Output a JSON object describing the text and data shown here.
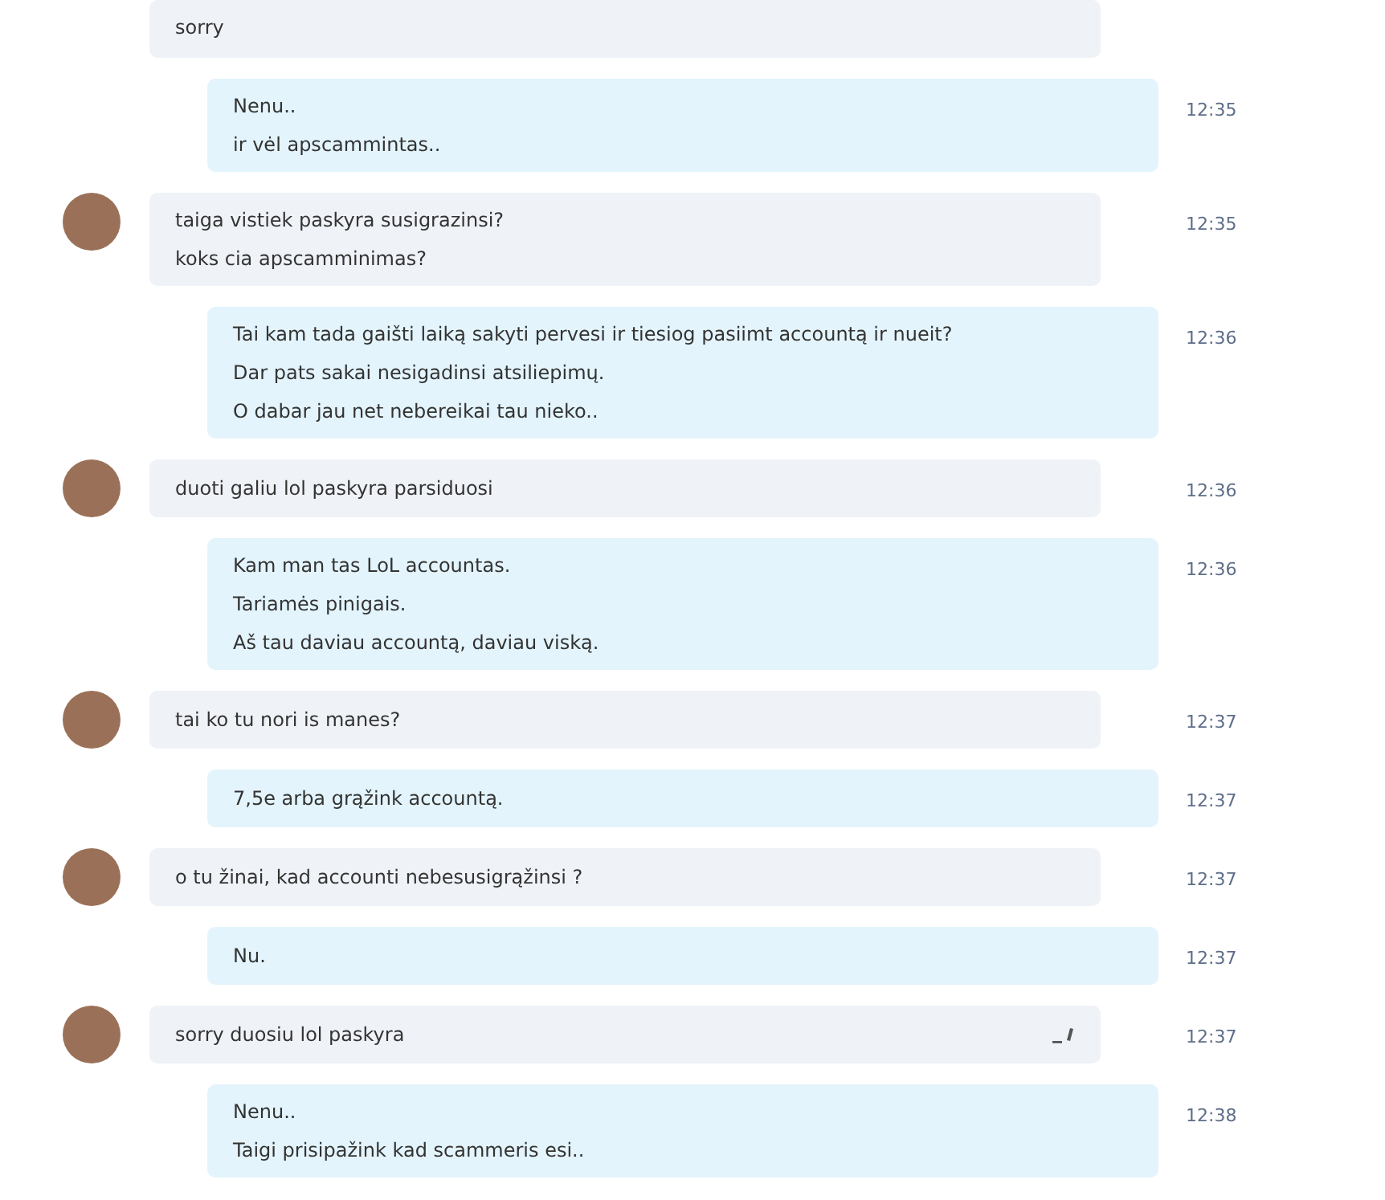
{
  "messages": [
    {
      "kind": "incoming",
      "avatar": false,
      "edited": false,
      "lines": [
        "sorry"
      ]
    },
    {
      "kind": "outgoing",
      "edited": false,
      "lines": [
        "Nenu..",
        "ir vėl apscammintas.."
      ],
      "time": "12:35"
    },
    {
      "kind": "incoming",
      "avatar": true,
      "edited": false,
      "lines": [
        "taiga vistiek paskyra susigrazinsi?",
        "koks cia apscamminimas?"
      ],
      "time": "12:35"
    },
    {
      "kind": "outgoing",
      "edited": false,
      "lines": [
        "Tai kam tada gaišti laiką sakyti pervesi ir tiesiog pasiimt accountą ir nueit?",
        "Dar pats sakai nesigadinsi atsiliepimų.",
        "O dabar jau net nebereikai tau nieko.."
      ],
      "time": "12:36"
    },
    {
      "kind": "incoming",
      "avatar": true,
      "edited": false,
      "lines": [
        "duoti galiu lol paskyra parsiduosi"
      ],
      "time": "12:36"
    },
    {
      "kind": "outgoing",
      "edited": false,
      "lines": [
        "Kam man tas LoL accountas.",
        "Tariamės pinigais.",
        "Aš tau daviau accountą, daviau viską."
      ],
      "time": "12:36"
    },
    {
      "kind": "incoming",
      "avatar": true,
      "edited": false,
      "lines": [
        "tai ko tu nori is manes?"
      ],
      "time": "12:37"
    },
    {
      "kind": "outgoing",
      "edited": false,
      "lines": [
        "7,5e arba grąžink accountą."
      ],
      "time": "12:37"
    },
    {
      "kind": "incoming",
      "avatar": true,
      "edited": false,
      "lines": [
        "o tu žinai, kad accounti nebesusigrąžinsi ?"
      ],
      "time": "12:37"
    },
    {
      "kind": "outgoing",
      "edited": false,
      "lines": [
        "Nu."
      ],
      "time": "12:37"
    },
    {
      "kind": "incoming",
      "avatar": true,
      "edited": true,
      "lines": [
        "sorry duosiu lol paskyra"
      ],
      "time": "12:37"
    },
    {
      "kind": "outgoing",
      "edited": false,
      "lines": [
        "Nenu..",
        "Taigi prisipažink kad scammeris esi.."
      ],
      "time": "12:38"
    }
  ]
}
